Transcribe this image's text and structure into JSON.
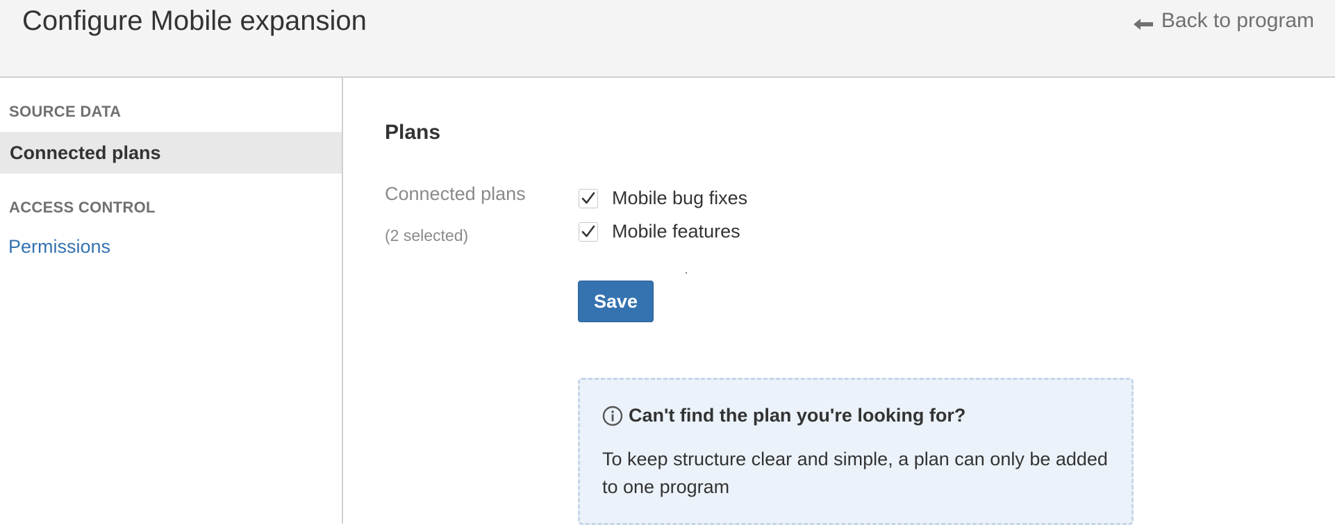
{
  "header": {
    "title": "Configure Mobile expansion",
    "back_label": "Back to program"
  },
  "sidebar": {
    "sections": [
      {
        "heading": "SOURCE DATA",
        "items": [
          {
            "label": "Connected plans",
            "active": true
          }
        ]
      },
      {
        "heading": "ACCESS CONTROL",
        "items": [
          {
            "label": "Permissions",
            "active": false
          }
        ]
      }
    ]
  },
  "main": {
    "section_title": "Plans",
    "field_label": "Connected plans",
    "field_sublabel": "(2 selected)",
    "plans": [
      {
        "label": "Mobile bug fixes",
        "checked": true
      },
      {
        "label": "Mobile features",
        "checked": true
      }
    ],
    "save_label": "Save",
    "info": {
      "title": "Can't find the plan you're looking for?",
      "body": "To keep structure clear and simple, a plan can only be added to one program"
    }
  },
  "colors": {
    "accent": "#3572b0",
    "header_bg": "#f4f4f4",
    "active_item_bg": "#e8e8e8",
    "info_bg": "#ebf2f9",
    "muted_text": "#8a8a8a"
  },
  "icons": {
    "back": "arrow-left-icon",
    "check": "checkmark-icon",
    "info": "info-circle-icon"
  }
}
